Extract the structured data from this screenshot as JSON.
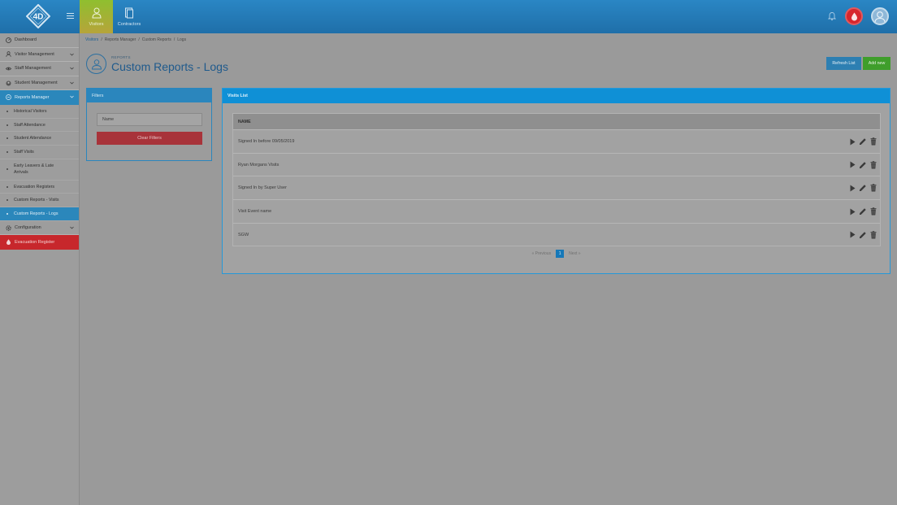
{
  "brand": {
    "logo_text": "4D"
  },
  "topnav": [
    {
      "label": "Visitors",
      "icon": "person-icon",
      "active": true
    },
    {
      "label": "Contractors",
      "icon": "document-icon",
      "active": false
    }
  ],
  "sidebar": {
    "items": [
      {
        "label": "Dashboard",
        "icon": "dashboard-icon"
      },
      {
        "label": "Visitor Management",
        "icon": "person-icon"
      },
      {
        "label": "Staff Management",
        "icon": "eye-icon"
      },
      {
        "label": "Student Management",
        "icon": "student-icon"
      },
      {
        "label": "Reports Manager",
        "icon": "reports-icon"
      }
    ],
    "sub_items": [
      {
        "label": "Historical Visitors"
      },
      {
        "label": "Staff Attendance"
      },
      {
        "label": "Student Attendance"
      },
      {
        "label": "Staff Visits"
      },
      {
        "label": "Early Leavers & Late Arrivals"
      },
      {
        "label": "Evacuation Registers"
      },
      {
        "label": "Custom Reports - Visits"
      },
      {
        "label": "Custom Reports - Logs"
      }
    ],
    "configuration": "Configuration",
    "evacuation": "Evacuation Register"
  },
  "breadcrumb": [
    "Visitors",
    "Reports Manager",
    "Custom Reports",
    "Logs"
  ],
  "breadcrumb_sep": "/",
  "page": {
    "kicker": "REPORTS",
    "title": "Custom Reports - Logs",
    "refresh_label": "Refresh List",
    "add_label": "Add new"
  },
  "filters": {
    "title": "Filters",
    "name_placeholder": "Name",
    "clear_label": "Clear Filters"
  },
  "visits": {
    "title": "Visits List",
    "column_name": "NAME",
    "rows": [
      "Signed In before 09/05/2019",
      "Ryan Morgans Visits",
      "Signed In by Super User",
      "Visit Event name",
      "SGW"
    ]
  },
  "pager": {
    "prev": "«  Previous",
    "current": "1",
    "next": "Next  »"
  },
  "colors": {
    "topbar": "#1f6fa9",
    "accent": "#0f90d6",
    "active_nav": "#8fbf2f",
    "danger": "#c7272c",
    "success": "#3f9e2b"
  }
}
